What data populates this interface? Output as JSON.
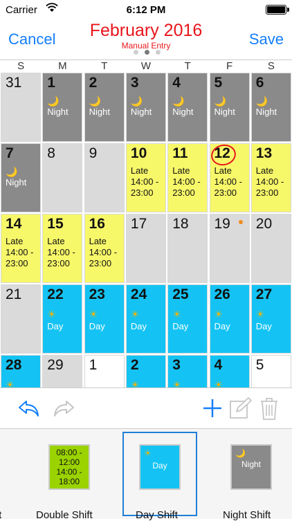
{
  "status_bar": {
    "carrier": "Carrier",
    "time": "6:12 PM"
  },
  "nav": {
    "cancel_label": "Cancel",
    "title": "February 2016",
    "subtitle": "Manual Entry",
    "save_label": "Save",
    "page_count": 3,
    "page_active": 1
  },
  "weekdays": [
    "S",
    "M",
    "T",
    "W",
    "T",
    "F",
    "S"
  ],
  "colors": {
    "night": "#8a8a8a",
    "late": "#f7f76a",
    "day": "#14c3f3",
    "empty": "#dadada",
    "double": "#9ad300",
    "accent": "#147efb",
    "title_red": "#e8151b"
  },
  "calendar": [
    {
      "num": "31",
      "shift": "",
      "label": ""
    },
    {
      "num": "1",
      "shift": "night",
      "label": "Night"
    },
    {
      "num": "2",
      "shift": "night",
      "label": "Night"
    },
    {
      "num": "3",
      "shift": "night",
      "label": "Night"
    },
    {
      "num": "4",
      "shift": "night",
      "label": "Night"
    },
    {
      "num": "5",
      "shift": "night",
      "label": "Night"
    },
    {
      "num": "6",
      "shift": "night",
      "label": "Night"
    },
    {
      "num": "7",
      "shift": "night",
      "label": "Night"
    },
    {
      "num": "8",
      "shift": "",
      "label": ""
    },
    {
      "num": "9",
      "shift": "",
      "label": ""
    },
    {
      "num": "10",
      "shift": "late",
      "label": "Late\n14:00 -\n23:00"
    },
    {
      "num": "11",
      "shift": "late",
      "label": "Late\n14:00 -\n23:00"
    },
    {
      "num": "12",
      "shift": "late",
      "label": "Late\n14:00 -\n23:00",
      "today": true
    },
    {
      "num": "13",
      "shift": "late",
      "label": "Late\n14:00 -\n23:00"
    },
    {
      "num": "14",
      "shift": "late",
      "label": "Late\n14:00 -\n23:00"
    },
    {
      "num": "15",
      "shift": "late",
      "label": "Late\n14:00 -\n23:00"
    },
    {
      "num": "16",
      "shift": "late",
      "label": "Late\n14:00 -\n23:00"
    },
    {
      "num": "17",
      "shift": "",
      "label": ""
    },
    {
      "num": "18",
      "shift": "",
      "label": ""
    },
    {
      "num": "19",
      "shift": "",
      "label": "",
      "dot": true
    },
    {
      "num": "20",
      "shift": "",
      "label": ""
    },
    {
      "num": "21",
      "shift": "",
      "label": ""
    },
    {
      "num": "22",
      "shift": "day",
      "label": "Day"
    },
    {
      "num": "23",
      "shift": "day",
      "label": "Day"
    },
    {
      "num": "24",
      "shift": "day",
      "label": "Day"
    },
    {
      "num": "25",
      "shift": "day",
      "label": "Day"
    },
    {
      "num": "26",
      "shift": "day",
      "label": "Day"
    },
    {
      "num": "27",
      "shift": "day",
      "label": "Day"
    },
    {
      "num": "28",
      "shift": "day",
      "label": ""
    },
    {
      "num": "29",
      "shift": "",
      "label": ""
    },
    {
      "num": "1",
      "shift": "plain",
      "label": ""
    },
    {
      "num": "2",
      "shift": "day",
      "label": ""
    },
    {
      "num": "3",
      "shift": "day",
      "label": ""
    },
    {
      "num": "4",
      "shift": "day",
      "label": ""
    },
    {
      "num": "5",
      "shift": "plain",
      "label": ""
    }
  ],
  "toolbar": {
    "undo": "undo-icon",
    "redo": "redo-icon",
    "add": "plus-icon",
    "edit": "edit-icon",
    "delete": "trash-icon"
  },
  "templates": [
    {
      "name": "ft",
      "swatch": "",
      "swatch_label": ""
    },
    {
      "name": "Double Shift",
      "swatch": "double",
      "swatch_label": "08:00 -\n12:00\n14:00 -\n18:00"
    },
    {
      "name": "Day Shift",
      "swatch": "day",
      "swatch_label": "Day",
      "selected": true
    },
    {
      "name": "Night Shift",
      "swatch": "night",
      "swatch_label": "Night"
    }
  ]
}
